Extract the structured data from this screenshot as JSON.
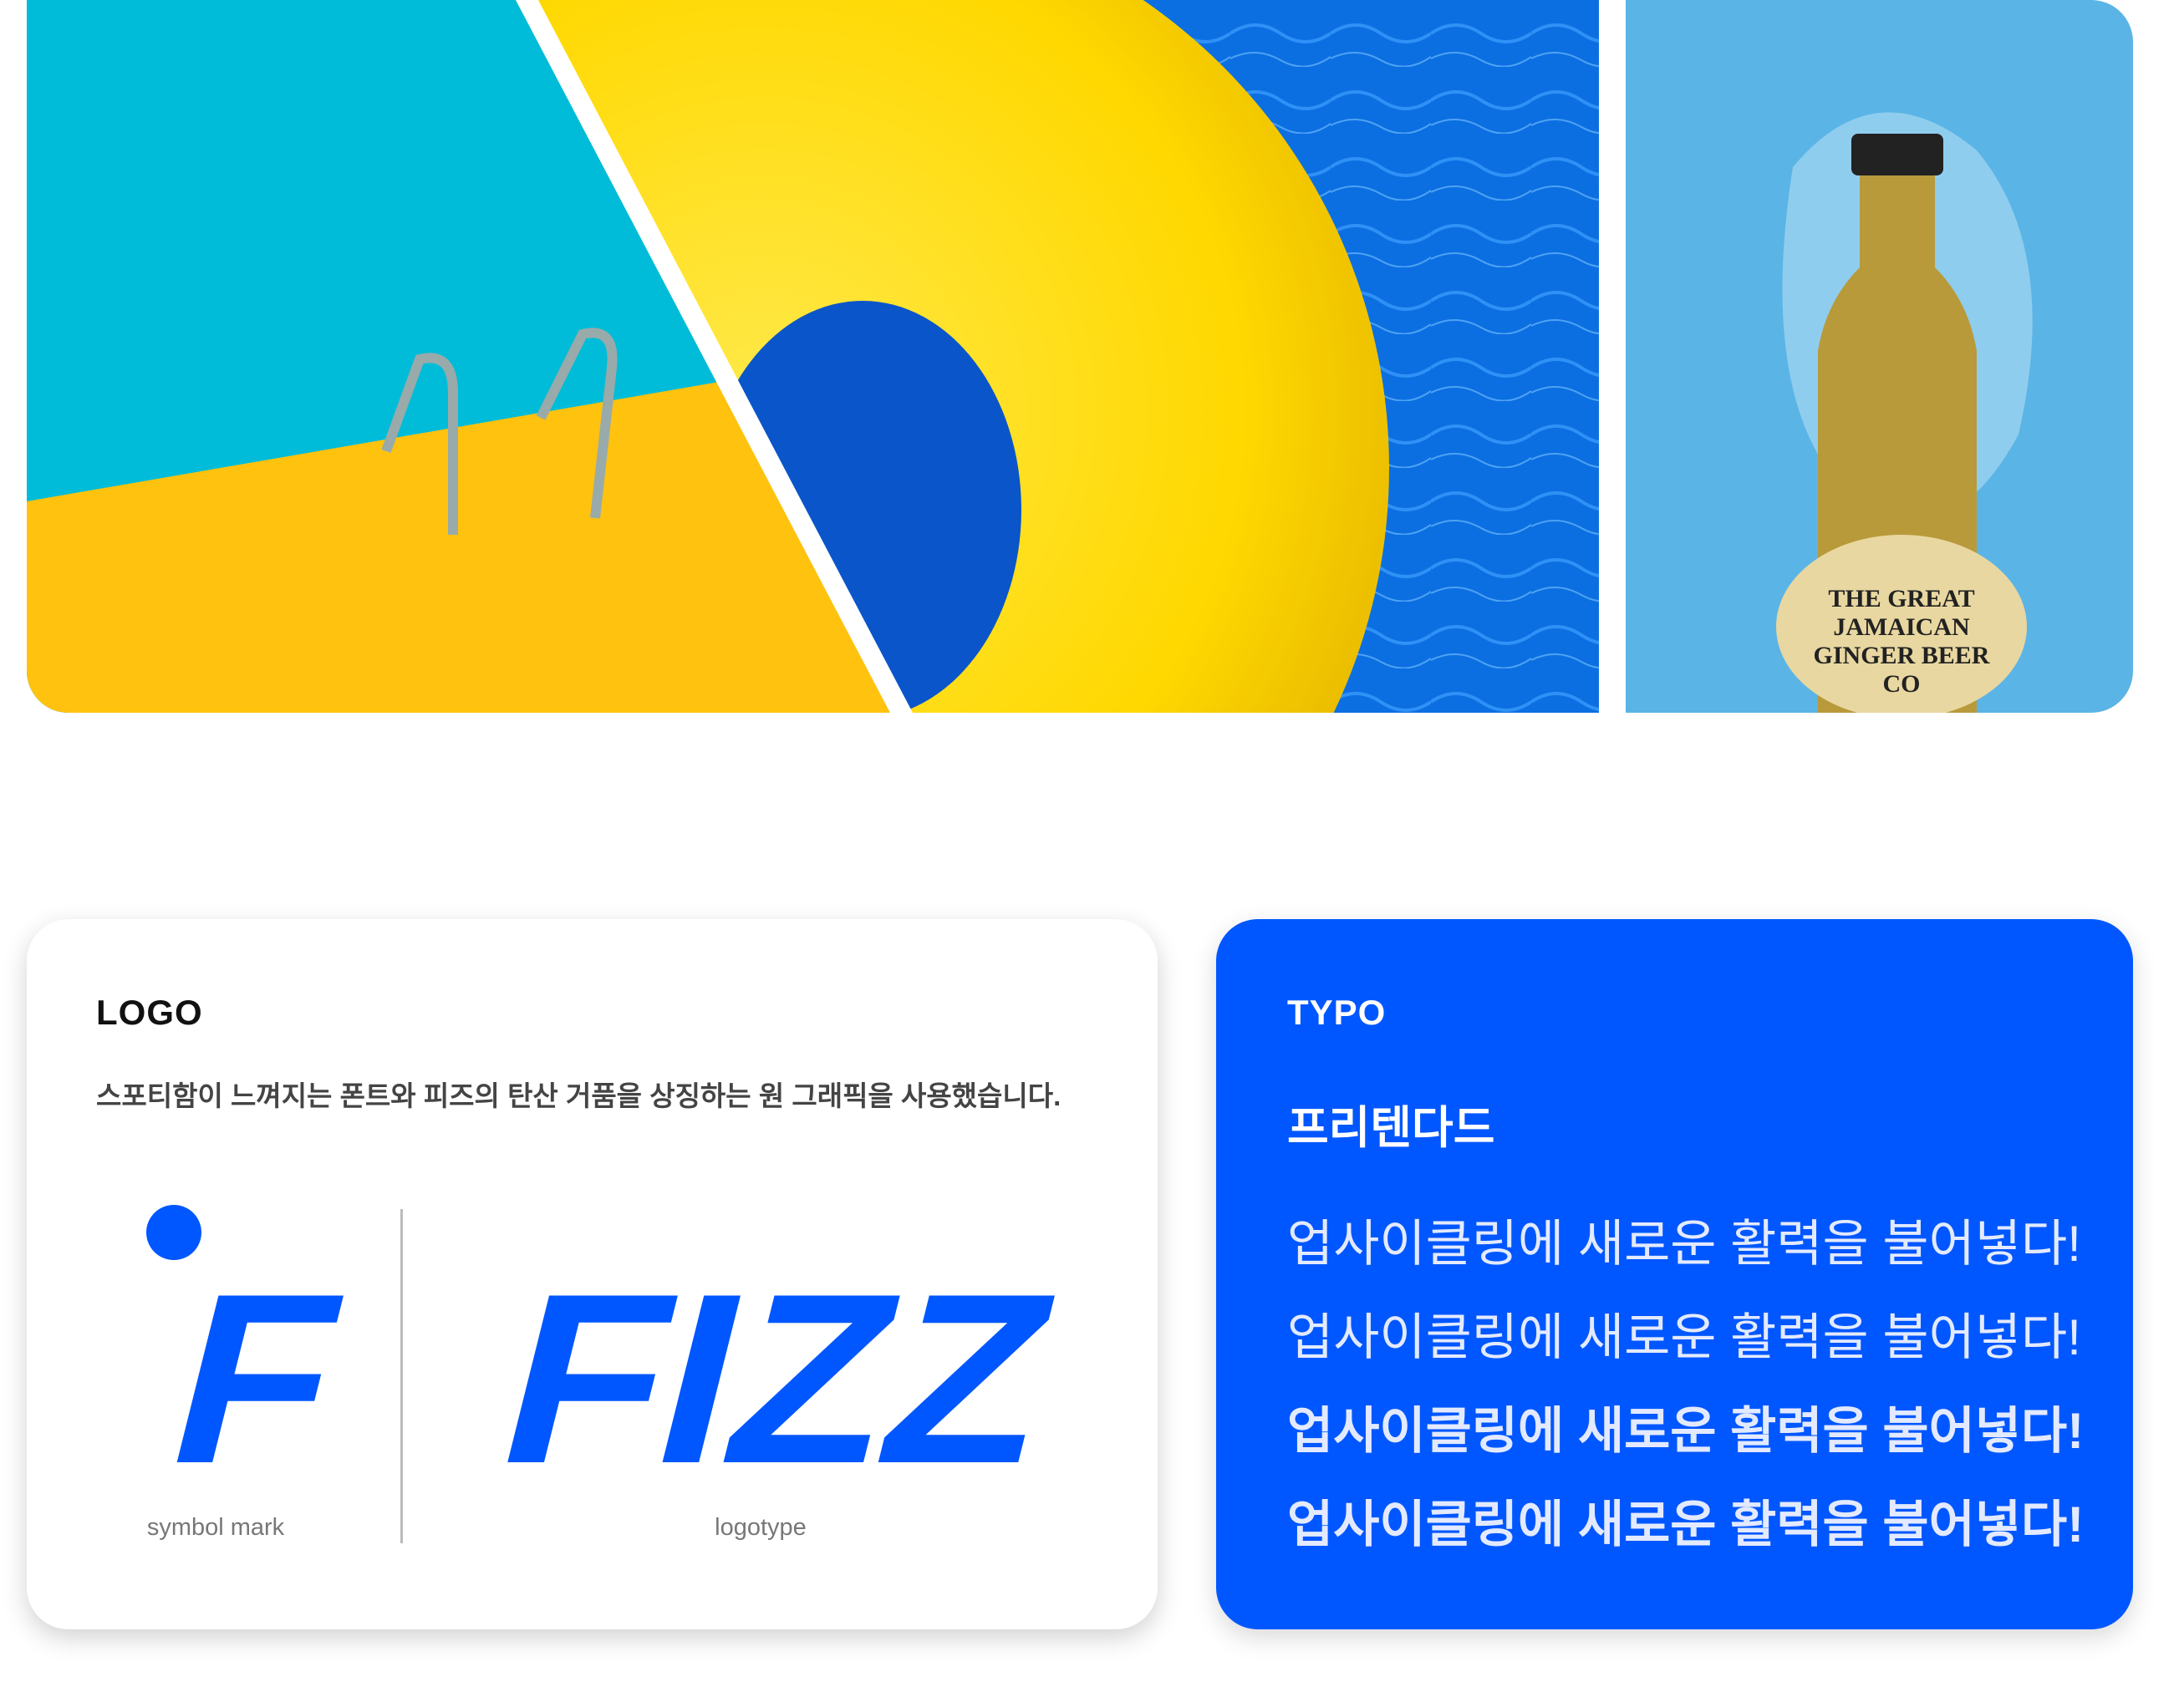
{
  "colors": {
    "brand_blue": "#0057FF",
    "pool_cyan": "#00BBD8",
    "deck_yellow": "#FFC107",
    "ring_yellow": "#FFE000",
    "water_blue": "#0A6FE0",
    "sky_blue": "#5BB4E6"
  },
  "photos": {
    "pool": {
      "icon": "pool-with-float-ring-photo"
    },
    "bottle": {
      "icon": "ginger-beer-bottle-splash-photo",
      "label_text": "THE GREAT JAMAICAN GINGER BEER CO"
    }
  },
  "logo_card": {
    "title": "LOGO",
    "description": "스포티함이 느껴지는 폰트와 피즈의 탄산 거품을 상징하는 원 그래픽을 사용했습니다.",
    "symbol_letter": "F",
    "symbol_label": "symbol mark",
    "logotype_text": "FIZZ",
    "logotype_label": "logotype"
  },
  "typo_card": {
    "title": "TYPO",
    "font_name": "프리텐다드",
    "samples": [
      "업사이클링에 새로운 활력을 불어넣다!",
      "업사이클링에 새로운 활력을 불어넣다!",
      "업사이클링에 새로운 활력을 불어넣다!",
      "업사이클링에 새로운 활력을 불어넣다!"
    ]
  }
}
